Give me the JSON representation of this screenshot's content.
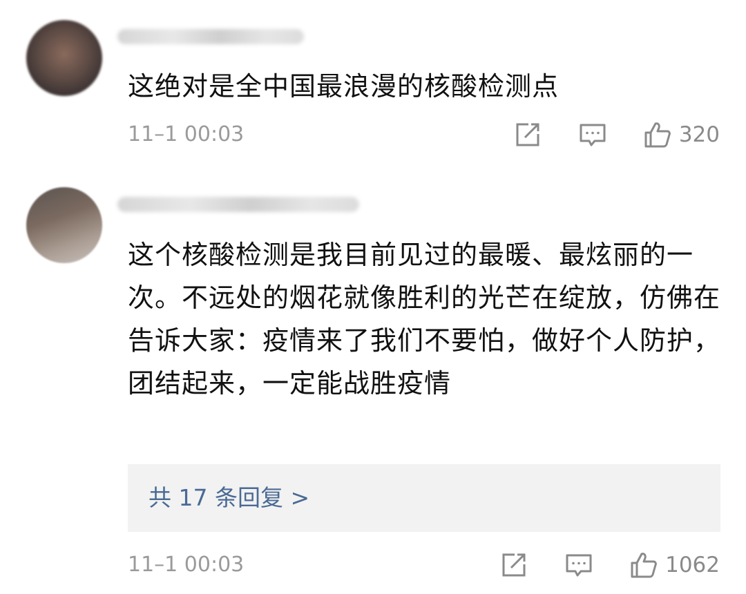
{
  "comments": [
    {
      "text": "这绝对是全中国最浪漫的核酸检测点",
      "time": "11–1 00:03",
      "likes": "320"
    },
    {
      "text": "这个核酸检测是我目前见过的最暖、最炫丽的一次。不远处的烟花就像胜利的光芒在绽放，仿佛在告诉大家：疫情来了我们不要怕，做好个人防护，团结起来，一定能战胜疫情",
      "time": "11–1 00:03",
      "likes": "1062",
      "replies_label": "共 17 条回复 >"
    }
  ],
  "icons": {
    "share": "share-icon",
    "comment": "comment-icon",
    "like": "thumbs-up-icon"
  },
  "colors": {
    "time": "#9a9a9a",
    "reply_link": "#4a6a94",
    "reply_bg": "#f2f2f2"
  }
}
